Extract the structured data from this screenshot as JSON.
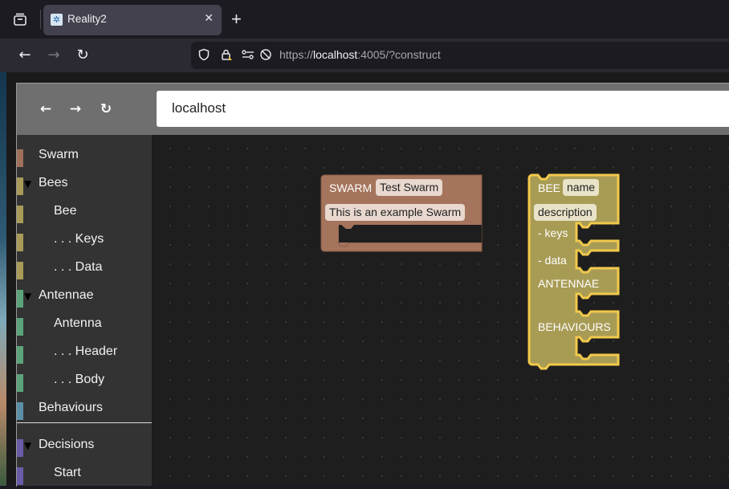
{
  "browser": {
    "tab": {
      "title": "Reality2"
    },
    "url": {
      "scheme": "https://",
      "host": "localhost",
      "rest": ":4005/?construct"
    }
  },
  "app": {
    "address": "localhost"
  },
  "sidebar": {
    "items": [
      {
        "label": "Swarm",
        "color": "#a0705a",
        "caret": false,
        "indent": false
      },
      {
        "label": "Bees",
        "color": "#a89a57",
        "caret": true,
        "indent": false
      },
      {
        "label": "Bee",
        "color": "#a89a57",
        "caret": false,
        "indent": true
      },
      {
        "label": ". . . Keys",
        "color": "#a89a57",
        "caret": false,
        "indent": true
      },
      {
        "label": ". . . Data",
        "color": "#a89a57",
        "caret": false,
        "indent": true
      },
      {
        "label": "Antennae",
        "color": "#5ba47a",
        "caret": true,
        "indent": false
      },
      {
        "label": "Antenna",
        "color": "#5ba47a",
        "caret": false,
        "indent": true
      },
      {
        "label": ". . . Header",
        "color": "#5ba47a",
        "caret": false,
        "indent": true
      },
      {
        "label": ". . . Body",
        "color": "#5ba47a",
        "caret": false,
        "indent": true
      },
      {
        "label": "Behaviours",
        "color": "#5b8fa8",
        "caret": false,
        "indent": false
      },
      {
        "label": "Decisions",
        "color": "#6a5ba8",
        "caret": true,
        "indent": false
      },
      {
        "label": "Start",
        "color": "#6a5ba8",
        "caret": false,
        "indent": true
      }
    ]
  },
  "blocks": {
    "swarm": {
      "keyword": "SWARM",
      "name": "Test Swarm",
      "description": "This is an example Swarm",
      "color": "#a5745c"
    },
    "bee": {
      "keyword": "BEE",
      "name": "name",
      "description": "description",
      "keys": "- keys",
      "data": "- data",
      "antennae": "ANTENNAE",
      "behaviours": "BEHAVIOURS",
      "color": "#a89c55",
      "highlight": "#f2c94c"
    }
  }
}
